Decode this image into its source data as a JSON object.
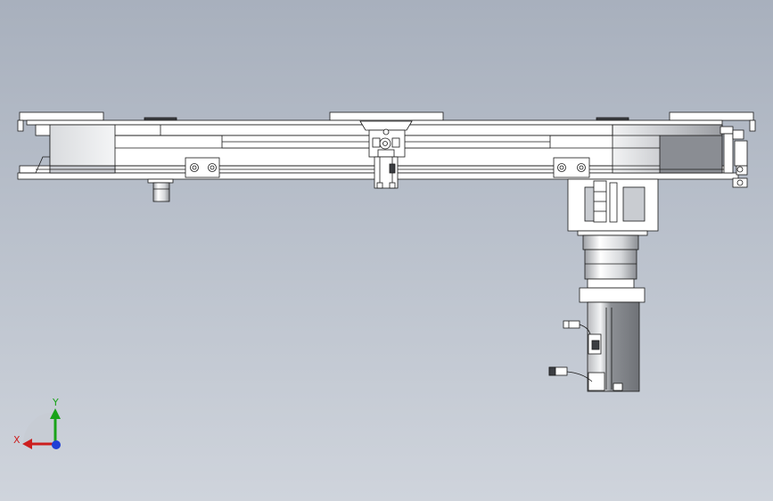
{
  "view": {
    "background_top": "#a8b0bd",
    "background_bottom": "#cfd4dc"
  },
  "triad": {
    "x_label": "X",
    "y_label": "Y",
    "x_color": "#cc1f1f",
    "y_color": "#19a319",
    "z_color": "#1f3fd6"
  },
  "model": {
    "part_fill": "#ffffff",
    "shade_fill": "#c9ccd1",
    "dark_fill": "#8a8d93",
    "motor_fill": "#9a9ca1",
    "line_color": "#1a1a1a"
  }
}
